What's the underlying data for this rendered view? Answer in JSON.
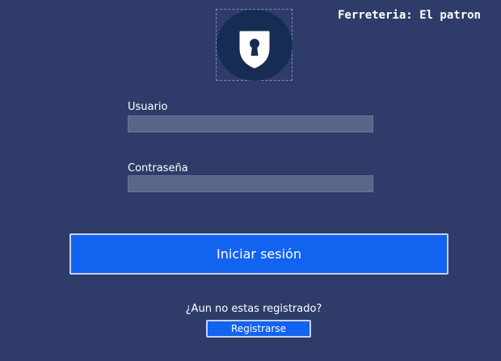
{
  "header": {
    "store_title": "Ferreteria: El patron"
  },
  "logo": {
    "icon": "keyhole-shield-icon"
  },
  "form": {
    "username_label": "Usuario",
    "username_value": "",
    "password_label": "Contraseña",
    "password_value": ""
  },
  "actions": {
    "login_label": "Iniciar sesión",
    "register_prompt": "¿Aun no estas registrado?",
    "register_label": "Registrarse"
  },
  "colors": {
    "background": "#2f3c6a",
    "primary_button": "#1263f0",
    "input_background": "#5a6688",
    "logo_circle": "#172c52"
  }
}
